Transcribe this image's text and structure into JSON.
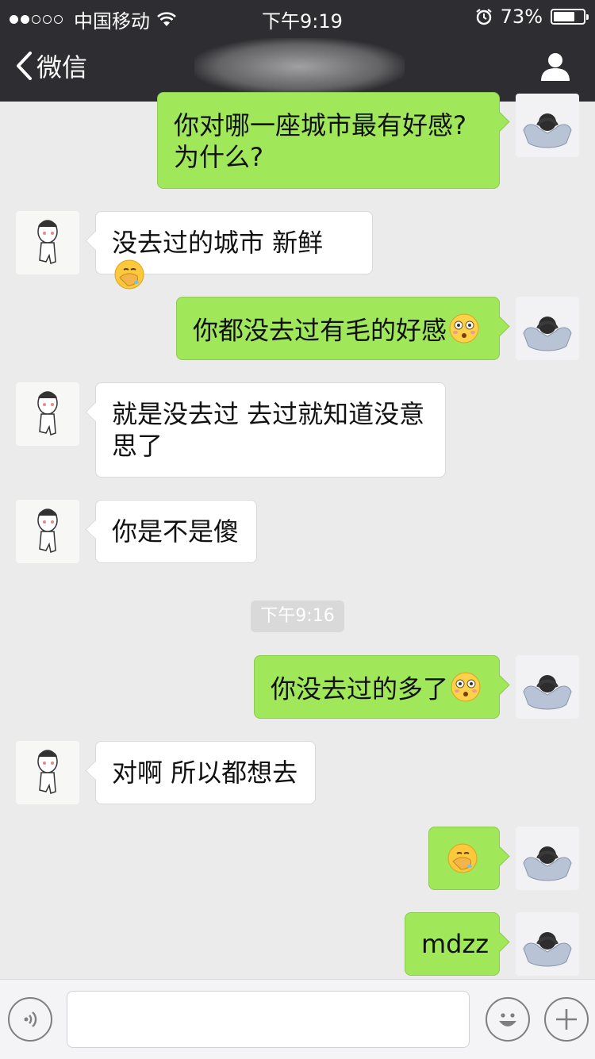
{
  "status_bar": {
    "carrier": "中国移动",
    "time": "下午9:19",
    "battery": "73%",
    "battery_level": 0.73
  },
  "nav": {
    "back_label": "微信"
  },
  "timestamp": "下午9:16",
  "messages": [
    {
      "from": "me",
      "text": "你对哪一座城市最有好感?为什么?"
    },
    {
      "from": "peer",
      "text": "没去过的城市 新鲜",
      "emoji": "facepalm-emoji"
    },
    {
      "from": "me",
      "text": "你都没去过有毛的好感",
      "emoji": "flushed-emoji"
    },
    {
      "from": "peer",
      "text": "就是没去过 去过就知道没意思了"
    },
    {
      "from": "peer",
      "text": "你是不是傻"
    },
    {
      "from": "me",
      "text": "你没去过的多了",
      "emoji": "flushed-emoji"
    },
    {
      "from": "peer",
      "text": "对啊 所以都想去"
    },
    {
      "from": "me",
      "text": "",
      "emoji": "facepalm-emoji"
    },
    {
      "from": "me",
      "text": "mdzz"
    }
  ],
  "input": {
    "value": ""
  }
}
